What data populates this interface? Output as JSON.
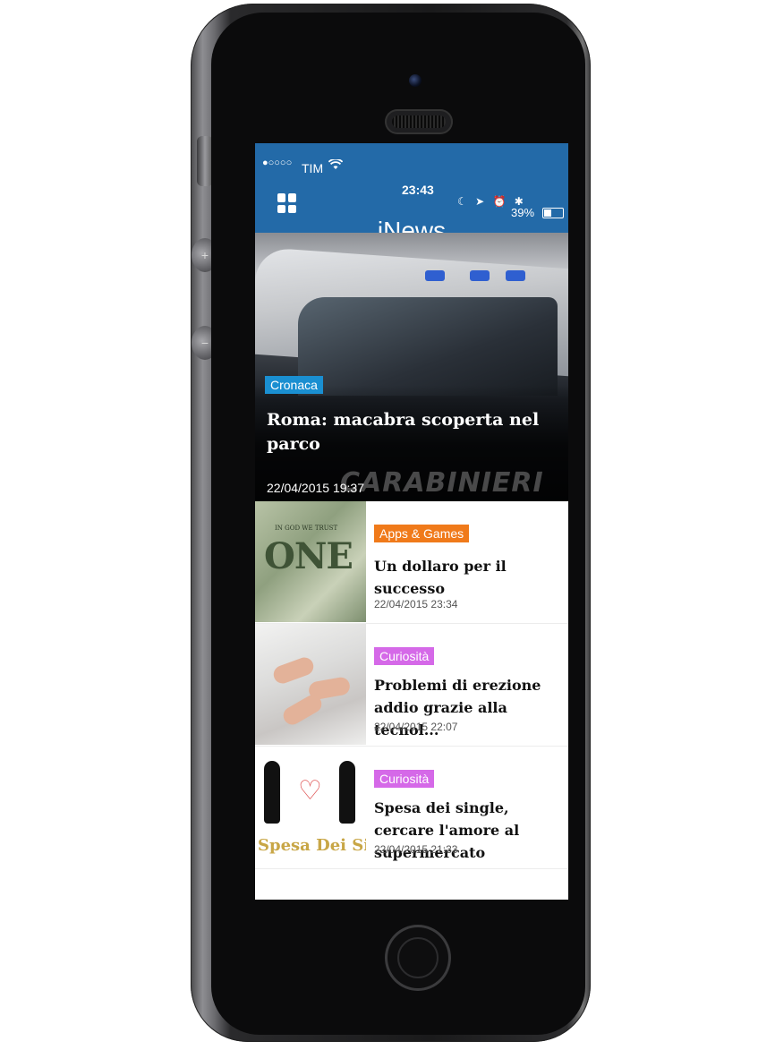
{
  "status_bar": {
    "signal": "●○○○○",
    "carrier": "TIM",
    "time": "23:43",
    "battery": "39%"
  },
  "header": {
    "title": "iNews"
  },
  "hero": {
    "category": "Cronaca",
    "category_color": "#1a8fd1",
    "title": "Roma: macabra scoperta nel parco",
    "date": "22/04/2015 19:37",
    "watermark": "CARABINIERI",
    "pages": 5,
    "active_page": 5
  },
  "articles": [
    {
      "category": "Apps & Games",
      "category_color": "#f07a1a",
      "title": "Un dollaro per il successo",
      "date": "22/04/2015 23:34",
      "thumb_text": "ONE",
      "thumb_small": "IN GOD WE TRUST"
    },
    {
      "category": "Curiosità",
      "category_color": "#d569e8",
      "title": "Problemi di erezione addio grazie alla tecnol...",
      "date": "22/04/2015 22:07"
    },
    {
      "category": "Curiosità",
      "category_color": "#d569e8",
      "title": "Spesa dei single, cercare l'amore al supermercato",
      "date": "22/04/2015 21:33",
      "thumb_text": "Spesa Dei Singl"
    }
  ],
  "colors": {
    "brand_blue": "#236aa8"
  },
  "icons": {
    "menu": "grid-icon",
    "settings": "toggle-icon",
    "wifi": "wifi-icon",
    "battery": "battery-icon"
  }
}
